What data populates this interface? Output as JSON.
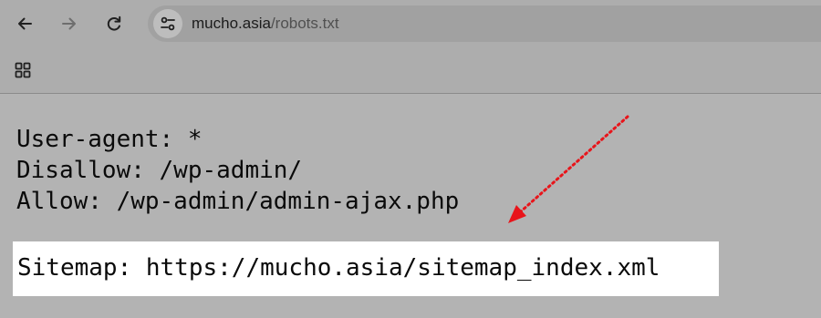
{
  "browser": {
    "url_host": "mucho.asia",
    "url_path": "/robots.txt",
    "icons": {
      "back": "arrow-left-icon",
      "forward": "arrow-right-icon",
      "reload": "reload-icon",
      "site_info": "tune-icon",
      "apps": "apps-grid-icon"
    }
  },
  "robots_txt": {
    "lines": [
      "User-agent: *",
      "Disallow: /wp-admin/",
      "Allow: /wp-admin/admin-ajax.php"
    ],
    "sitemap_line": "Sitemap: https://mucho.asia/sitemap_index.xml"
  },
  "annotation": {
    "arrow_color": "#e8141a",
    "style": "dotted",
    "points_to": "sitemap line"
  }
}
